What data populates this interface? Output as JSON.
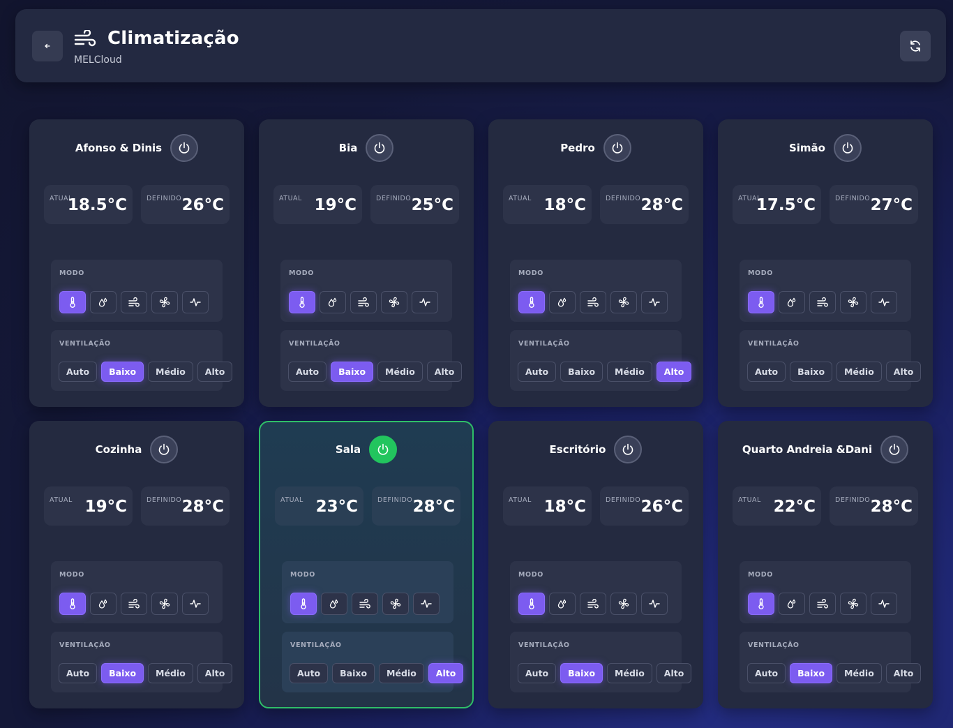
{
  "header": {
    "title": "Climatização",
    "subtitle": "MELCloud",
    "back_icon": "arrow-left-icon",
    "logo_icon": "wind-icon",
    "refresh_icon": "refresh-icon"
  },
  "labels": {
    "current": "ATUAL",
    "target": "DEFINIDO",
    "mode": "MODO",
    "fan": "VENTILAÇÃO"
  },
  "mode_options": [
    "heat",
    "dry",
    "fan",
    "cool",
    "auto"
  ],
  "fan_options": [
    "Auto",
    "Baixo",
    "Médio",
    "Alto"
  ],
  "colors": {
    "accent": "#7c5cf0",
    "power_on": "#22c55e",
    "active_border": "#2fbf68",
    "card": "#242a40"
  },
  "rooms": [
    {
      "name": "Afonso & Dinis",
      "power": "off",
      "current": "18.5°C",
      "target": "26°C",
      "mode": "heat",
      "fan": "Baixo"
    },
    {
      "name": "Bia",
      "power": "off",
      "current": "19°C",
      "target": "25°C",
      "mode": "heat",
      "fan": "Baixo"
    },
    {
      "name": "Pedro",
      "power": "off",
      "current": "18°C",
      "target": "28°C",
      "mode": "heat",
      "fan": "Alto"
    },
    {
      "name": "Simão",
      "power": "off",
      "current": "17.5°C",
      "target": "27°C",
      "mode": "heat",
      "fan": ""
    },
    {
      "name": "Cozinha",
      "power": "off",
      "current": "19°C",
      "target": "28°C",
      "mode": "heat",
      "fan": "Baixo"
    },
    {
      "name": "Sala",
      "power": "on",
      "current": "23°C",
      "target": "28°C",
      "mode": "heat",
      "fan": "Alto"
    },
    {
      "name": "Escritório",
      "power": "off",
      "current": "18°C",
      "target": "26°C",
      "mode": "heat",
      "fan": "Baixo"
    },
    {
      "name": "Quarto Andreia &Dani",
      "power": "off",
      "current": "22°C",
      "target": "28°C",
      "mode": "heat",
      "fan": "Baixo"
    }
  ]
}
